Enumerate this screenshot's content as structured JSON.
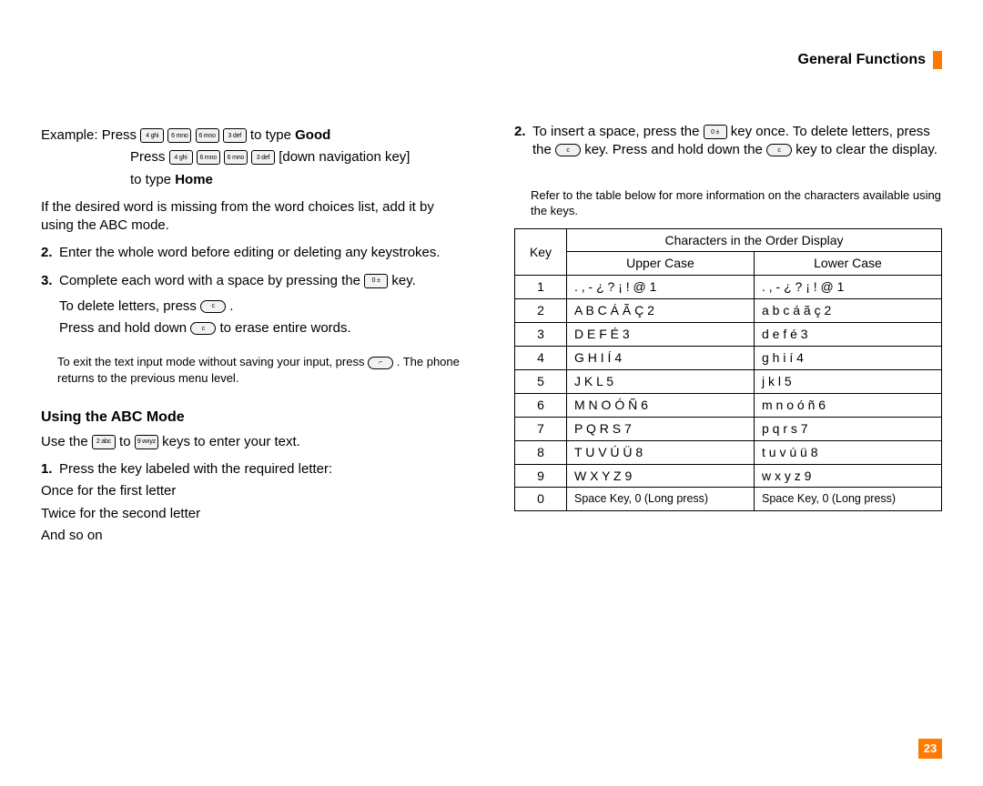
{
  "header": {
    "title": "General Functions"
  },
  "page_number": "23",
  "keys": {
    "k4": "4 ghi",
    "k6": "6 mno",
    "k3": "3 def",
    "k0": "0 ±",
    "kc": "c",
    "kend": "⌐",
    "k2": "2 abc",
    "k9": "9 wxyz"
  },
  "left": {
    "example_label": "Example: Press",
    "example_to_type": "to type",
    "example_word1": "Good",
    "example_press2": "Press",
    "example_nav": "[down navigation key]",
    "example_word2": "Home",
    "missing_word": "If the desired word is missing from the word choices list, add it by using the ABC mode.",
    "item2_n": "2.",
    "item2_t": "Enter the whole word before editing or deleting any keystrokes.",
    "item3_n": "3.",
    "item3_t_a": "Complete each word with a space by pressing the",
    "item3_t_b": "key.",
    "delete_a": "To delete letters, press",
    "delete_b": ".",
    "erase_a": "Press and hold down",
    "erase_b": "to erase entire words.",
    "exit_a": "To exit the text input mode without saving your input, press",
    "exit_b": ". The phone returns to the previous menu level.",
    "abc_title": "Using the ABC Mode",
    "abc_use_a": "Use the",
    "abc_use_mid": "to",
    "abc_use_b": "keys to enter your text.",
    "abc_item1_n": "1.",
    "abc_item1_t": "Press the key labeled with the required letter:",
    "abc_once": "Once for the first letter",
    "abc_twice": "Twice for the second letter",
    "abc_andso": "And so on"
  },
  "right": {
    "item2_n": "2.",
    "item2_a": "To insert a space, press the",
    "item2_b": "key once. To delete letters, press the",
    "item2_c": "key. Press and hold down the",
    "item2_d": "key to clear the display.",
    "table_note": "Refer to the table below for more information on the characters available using the keys.",
    "th_key": "Key",
    "th_chars": "Characters in the Order Display",
    "th_upper": "Upper Case",
    "th_lower": "Lower Case"
  },
  "chart_data": {
    "type": "table",
    "title": "Characters in the Order Display",
    "columns": [
      "Key",
      "Upper Case",
      "Lower Case"
    ],
    "rows": [
      {
        "key": "1",
        "upper": ". , - ¿ ? ¡ ! @ 1",
        "lower": ". , - ¿ ? ¡ ! @ 1"
      },
      {
        "key": "2",
        "upper": "A B C Á Ã Ç 2",
        "lower": "a b c á ã ç 2"
      },
      {
        "key": "3",
        "upper": "D E F É 3",
        "lower": "d e f é 3"
      },
      {
        "key": "4",
        "upper": "G H I Í 4",
        "lower": "g h i í 4"
      },
      {
        "key": "5",
        "upper": "J K L 5",
        "lower": "j k l 5"
      },
      {
        "key": "6",
        "upper": "M N O Ó Ñ 6",
        "lower": "m n o ó ñ 6"
      },
      {
        "key": "7",
        "upper": "P Q R S 7",
        "lower": "p q r s 7"
      },
      {
        "key": "8",
        "upper": "T U V Ú Ü 8",
        "lower": "t u v ú ü 8"
      },
      {
        "key": "9",
        "upper": "W X Y Z 9",
        "lower": "w x y z 9"
      },
      {
        "key": "0",
        "upper": "Space Key, 0 (Long press)",
        "lower": "Space Key, 0 (Long press)"
      }
    ]
  }
}
